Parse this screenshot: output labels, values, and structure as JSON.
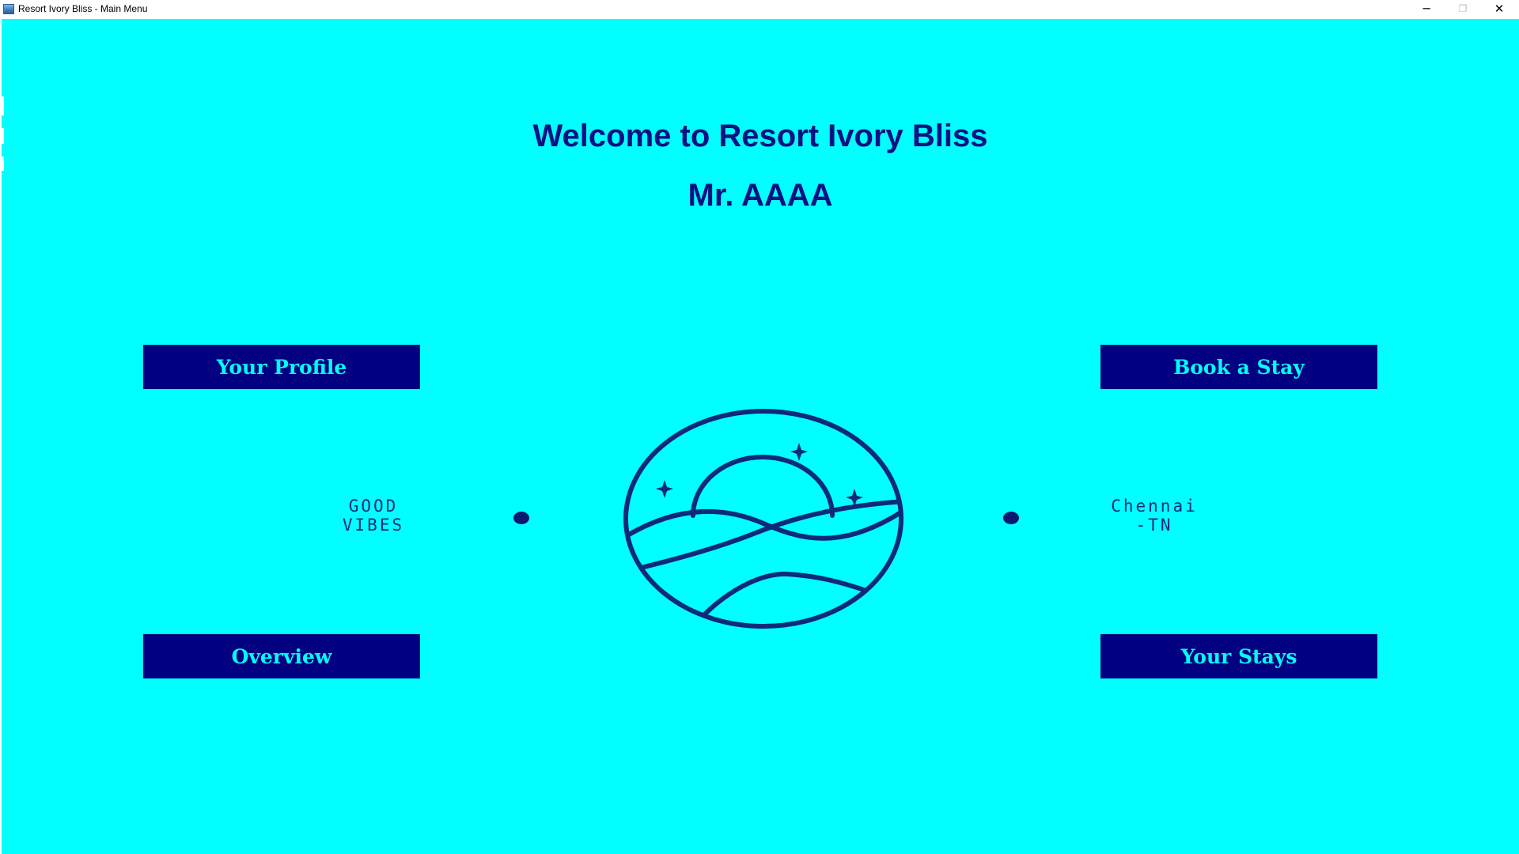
{
  "window": {
    "title": "Resort Ivory Bliss - Main Menu",
    "controls": {
      "minimize": "─",
      "restore": "❐",
      "close": "✕"
    }
  },
  "header": {
    "welcome": "Welcome to Resort Ivory Bliss",
    "user_name": "Mr. AAAA"
  },
  "buttons": {
    "profile": "Your Profile",
    "book": "Book a Stay",
    "overview": "Overview",
    "stays": "Your Stays"
  },
  "decor": {
    "left_line1": "GOOD",
    "left_line2": "VIBES",
    "right_line1": "Chennai",
    "right_line2": "-TN"
  },
  "icons": {
    "app": "app-icon",
    "logo": "sunset-waves-logo-icon",
    "dots": "dot-icon"
  },
  "colors": {
    "background": "#00ffff",
    "button_bg": "#000080",
    "button_text": "#00ffff",
    "heading": "#0a1183"
  }
}
